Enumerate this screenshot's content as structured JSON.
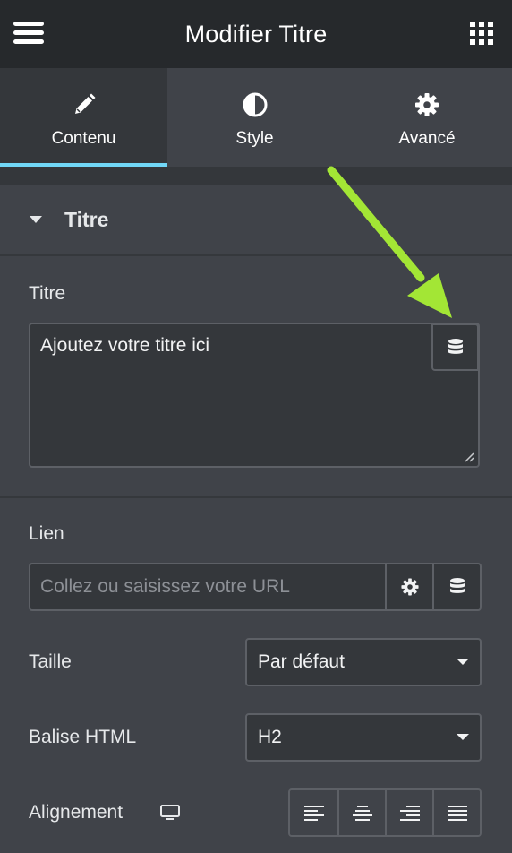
{
  "header": {
    "title": "Modifier Titre"
  },
  "tabs": [
    {
      "label": "Contenu",
      "icon": "pencil-icon",
      "active": true
    },
    {
      "label": "Style",
      "icon": "contrast-icon",
      "active": false
    },
    {
      "label": "Avancé",
      "icon": "gear-icon",
      "active": false
    }
  ],
  "section": {
    "title": "Titre"
  },
  "fields": {
    "titre": {
      "label": "Titre",
      "value": "Ajoutez votre titre ici"
    },
    "lien": {
      "label": "Lien",
      "placeholder": "Collez ou saisissez votre URL"
    },
    "taille": {
      "label": "Taille",
      "value": "Par défaut"
    },
    "balise": {
      "label": "Balise HTML",
      "value": "H2"
    },
    "alignement": {
      "label": "Alignement",
      "options": [
        "left",
        "center",
        "right",
        "justify"
      ]
    }
  },
  "colors": {
    "accent": "#71d7f7",
    "arrow": "#a3e635",
    "header_bg": "#26292c",
    "panel_bg": "#404349"
  }
}
